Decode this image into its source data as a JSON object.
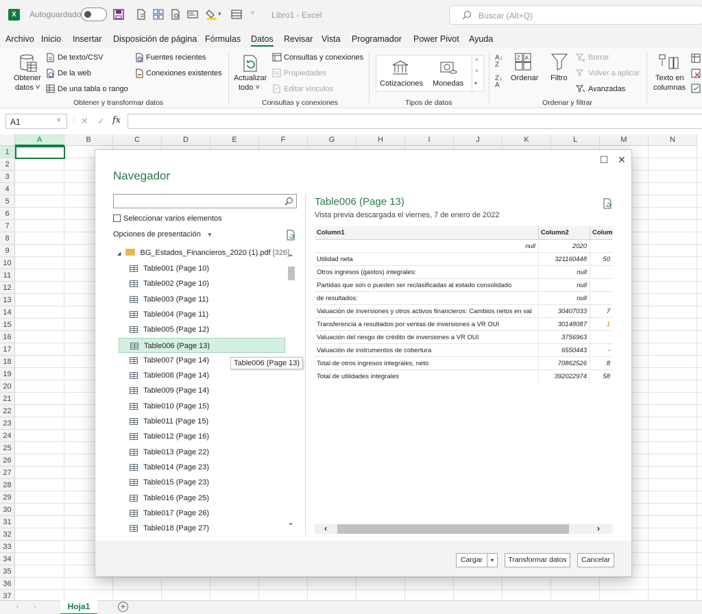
{
  "titlebar": {
    "autosave_label": "Autoguardado",
    "doc_title": "Libro1  -  Excel",
    "search_placeholder": "Buscar (Alt+Q)"
  },
  "menu": [
    "Archivo",
    "Inicio",
    "Insertar",
    "Disposición de página",
    "Fórmulas",
    "Datos",
    "Revisar",
    "Vista",
    "Programador",
    "Power Pivot",
    "Ayuda"
  ],
  "active_menu": "Datos",
  "ribbon": {
    "obtener_datos": [
      "Obtener",
      "datos ˅"
    ],
    "de_texto_csv": "De texto/CSV",
    "de_la_web": "De la web",
    "de_una_tabla": "De una tabla o rango",
    "fuentes_recientes": "Fuentes recientes",
    "conexiones_existentes": "Conexiones existentes",
    "group1": "Obtener y transformar datos",
    "actualizar_todo": [
      "Actualizar",
      "todo ˅"
    ],
    "consultas_conexiones": "Consultas y conexiones",
    "propiedades": "Propiedades",
    "editar_vinculos": "Editar vínculos",
    "group2": "Consultas y conexiones",
    "cotizaciones": "Cotizaciones",
    "monedas": "Monedas",
    "group3": "Tipos de datos",
    "ordenar": "Ordenar",
    "filtro": "Filtro",
    "borrar": "Borrar",
    "volver_aplicar": "Volver a aplicar",
    "avanzadas": "Avanzadas",
    "group4": "Ordenar y filtrar",
    "texto_columnas": [
      "Texto en",
      "columnas"
    ]
  },
  "formula_bar": {
    "name_box": "A1",
    "fx": "fx"
  },
  "grid": {
    "columns": [
      "A",
      "B",
      "C",
      "D",
      "E",
      "F",
      "G",
      "H",
      "I",
      "J",
      "K",
      "L",
      "M",
      "N"
    ],
    "rows": [
      "1",
      "2",
      "3",
      "4",
      "5",
      "6",
      "7",
      "8",
      "9",
      "10",
      "11",
      "12",
      "13",
      "14",
      "15",
      "16",
      "17",
      "18",
      "19",
      "20",
      "21",
      "22",
      "23",
      "24",
      "25",
      "26",
      "27",
      "28",
      "29",
      "30",
      "31",
      "32",
      "33",
      "34",
      "35",
      "36",
      "37"
    ],
    "selected_cell": "A1"
  },
  "sheet_tab": "Hoja1",
  "navigator": {
    "title": "Navegador",
    "select_multiple": "Seleccionar varios elementos",
    "display_options": "Opciones de presentación",
    "root": "BG_Estados_Financieros_2020 (1).pdf",
    "root_count": "[326]",
    "items": [
      "Table001 (Page 10)",
      "Table002 (Page 10)",
      "Table003 (Page 11)",
      "Table004 (Page 11)",
      "Table005 (Page 12)",
      "Table006 (Page 13)",
      "Table007 (Page 14)",
      "Table008 (Page 14)",
      "Table009 (Page 14)",
      "Table010 (Page 15)",
      "Table011 (Page 15)",
      "Table012 (Page 16)",
      "Table013 (Page 22)",
      "Table014 (Page 23)",
      "Table015 (Page 23)",
      "Table016 (Page 25)",
      "Table017 (Page 26)",
      "Table018 (Page 27)"
    ],
    "selected_item": "Table006 (Page 13)",
    "tooltip": "Table006 (Page 13)",
    "preview": {
      "title": "Table006 (Page 13)",
      "subtitle": "Vista previa descargada el viernes, 7 de enero de 2022",
      "headers": [
        "Column1",
        "Column2",
        "Colum"
      ],
      "rows": [
        [
          "null",
          "2020",
          ""
        ],
        [
          "Utilidad neta",
          "321160448",
          "50"
        ],
        [
          "Otros ingresos (gastos) integrales:",
          "null",
          ""
        ],
        [
          "Partidas que son o pueden ser reclasificadas al estado consolidado",
          "null",
          ""
        ],
        [
          "de resultados:",
          "null",
          ""
        ],
        [
          "Valuación de inversiones y otros activos financieros: Cambios netos en val",
          "30407033",
          "7"
        ],
        [
          "Transferencia a resultados por ventas de inversiones a VR OUI",
          "30148087",
          "1"
        ],
        [
          "Valuación del riesgo de crédito de inversiones a VR OUI",
          "3756963",
          ""
        ],
        [
          "Valuación de instrumentos de cobertura",
          "6550443",
          "-"
        ],
        [
          "Total de otros ingresos integrales, neto",
          "70862526",
          "8"
        ],
        [
          "Total de utilidades integrales",
          "392022974",
          "58"
        ]
      ]
    },
    "buttons": {
      "cargar": "Cargar",
      "transformar": "Transformar datos",
      "cancelar": "Cancelar"
    }
  },
  "colors": {
    "accent": "#107c41",
    "title_green": "#2b7a4b",
    "selection": "#d3f0e0"
  }
}
